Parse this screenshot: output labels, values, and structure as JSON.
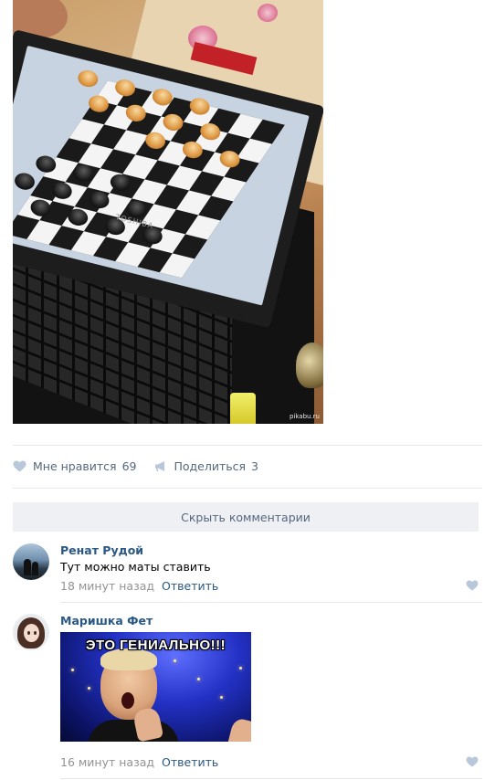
{
  "photo": {
    "laptop_brand": "TOSHIBA",
    "watermark": "pikabu.ru"
  },
  "actions": {
    "like_label": "Мне нравится",
    "like_count": "69",
    "share_label": "Поделиться",
    "share_count": "3"
  },
  "hide_comments_label": "Скрыть комментарии",
  "comments": [
    {
      "author": "Ренат Рудой",
      "text": "Тут можно маты ставить",
      "time": "18 минут назад",
      "reply_label": "Ответить"
    },
    {
      "author": "Маришка Фет",
      "image_caption": "ЭТО ГЕНИАЛЬНО!!!",
      "time": "16 минут назад",
      "reply_label": "Ответить"
    }
  ],
  "colors": {
    "link": "#2a5885",
    "muted": "#939393",
    "action_text": "#55677d",
    "icon": "#b8c7d9",
    "button_bg": "#eef0f3",
    "divider": "#e7e8ec"
  },
  "icons": {
    "like": "heart-icon",
    "share": "megaphone-icon",
    "comment_like": "heart-icon"
  }
}
